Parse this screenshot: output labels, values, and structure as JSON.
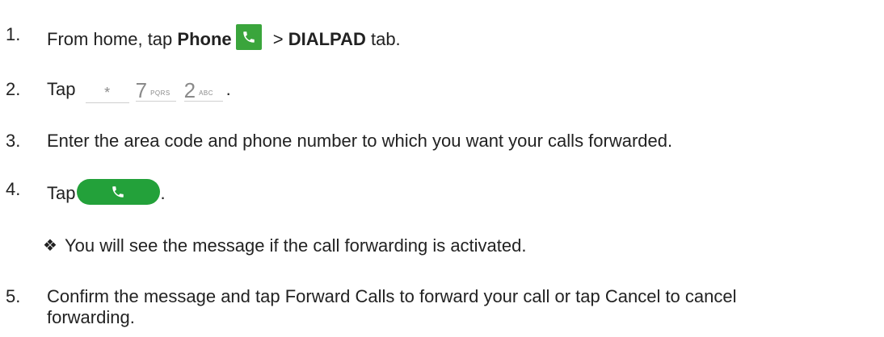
{
  "steps": [
    {
      "num": "1.",
      "pre": "From home, tap ",
      "bold1": "Phone",
      "mid": " > ",
      "bold2": "DIALPAD",
      "post": " tab."
    },
    {
      "num": "2.",
      "pre": "Tap",
      "keys": [
        {
          "main": "*",
          "sub": ""
        },
        {
          "main": "7",
          "sub": "PQRS"
        },
        {
          "main": "2",
          "sub": "ABC"
        }
      ],
      "post": "."
    },
    {
      "num": "3.",
      "text": "Enter the area code and phone number to which you want your calls forwarded."
    },
    {
      "num": "4.",
      "pre": "Tap",
      "post": "."
    },
    {
      "num": "5.",
      "line1": "Confirm the message and tap Forward Calls to forward your call or tap Cancel to cancel",
      "line2": "forwarding."
    }
  ],
  "bullet": {
    "glyph": "❖",
    "text": "You will see the message if the call forwarding is activated."
  },
  "icons": {
    "phone": "phone-icon",
    "call_button": "call-button-icon"
  },
  "colors": {
    "phone_icon_bg": "#3aa53c",
    "call_button_bg": "#23a13a"
  }
}
